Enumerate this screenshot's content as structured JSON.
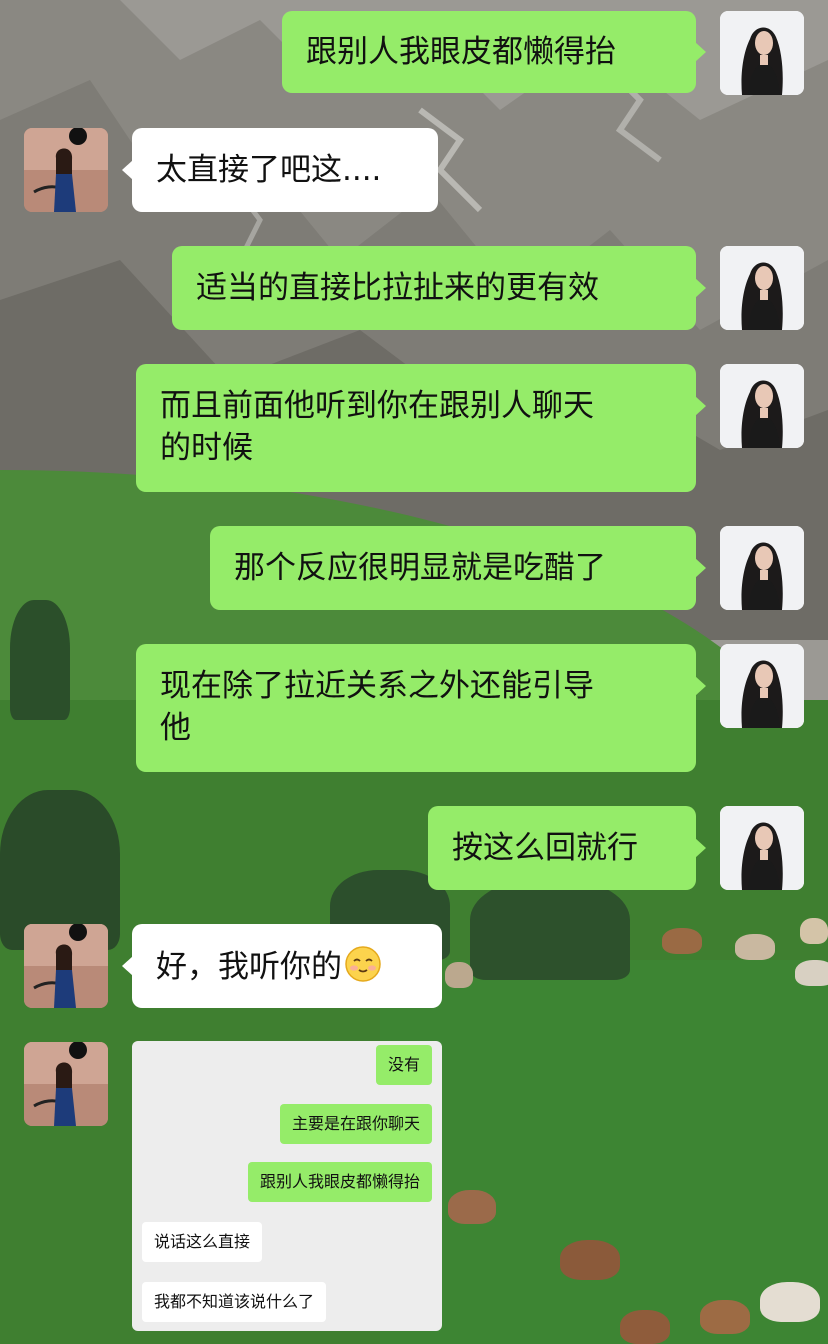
{
  "messages": [
    {
      "side": "me",
      "text": "跟别人我眼皮都懒得抬"
    },
    {
      "side": "them",
      "text": "太直接了吧这...."
    },
    {
      "side": "me",
      "text": "适当的直接比拉扯来的更有效"
    },
    {
      "side": "me",
      "line1": "而且前面他听到你在跟别人聊天",
      "line2": "的时候"
    },
    {
      "side": "me",
      "text": "那个反应很明显就是吃醋了"
    },
    {
      "side": "me",
      "line1": "现在除了拉近关系之外还能引导",
      "line2": "他"
    },
    {
      "side": "me",
      "text": "按这么回就行"
    },
    {
      "side": "them",
      "text": "好，我听你的",
      "emoji": "smiling-face-emoji"
    }
  ],
  "screenshot": {
    "messages": [
      {
        "side": "me",
        "text": "没有"
      },
      {
        "side": "me",
        "text": "主要是在跟你聊天"
      },
      {
        "side": "me",
        "text": "跟别人我眼皮都懒得抬"
      },
      {
        "side": "them",
        "text": "说话这么直接"
      },
      {
        "side": "them",
        "text": "我都不知道该说什么了"
      }
    ]
  },
  "colors": {
    "my_bubble": "#95ec69",
    "their_bubble": "#ffffff",
    "card_bg": "#ededed"
  }
}
